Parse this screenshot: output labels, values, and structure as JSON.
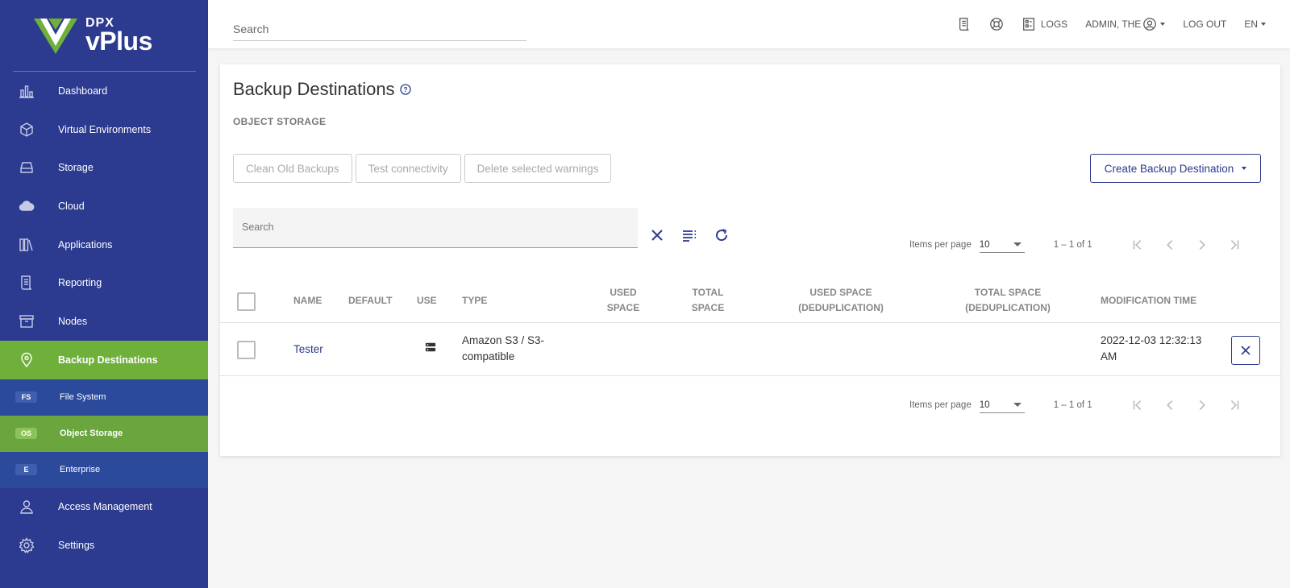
{
  "app": {
    "logo": {
      "brand_small": "DPX",
      "brand_large": "vPlus"
    }
  },
  "sidebar": {
    "items": [
      {
        "label": "Dashboard",
        "icon": "bar-chart-icon"
      },
      {
        "label": "Virtual Environments",
        "icon": "cube-icon"
      },
      {
        "label": "Storage",
        "icon": "hard-drive-icon"
      },
      {
        "label": "Cloud",
        "icon": "cloud-icon"
      },
      {
        "label": "Applications",
        "icon": "books-icon"
      },
      {
        "label": "Reporting",
        "icon": "report-icon"
      },
      {
        "label": "Nodes",
        "icon": "archive-box-icon"
      },
      {
        "label": "Backup Destinations",
        "icon": "location-pin-icon",
        "active": true
      },
      {
        "label": "Access Management",
        "icon": "user-icon"
      },
      {
        "label": "Settings",
        "icon": "gear-icon"
      }
    ],
    "sub_items": [
      {
        "badge": "FS",
        "label": "File System"
      },
      {
        "badge": "OS",
        "label": "Object Storage",
        "active": true
      },
      {
        "badge": "E",
        "label": "Enterprise"
      }
    ],
    "colors": {
      "background": "#2c3a8f",
      "active": "#6fb03a"
    }
  },
  "topbar": {
    "search_placeholder": "Search",
    "logs_label": "LOGS",
    "user_label": "ADMIN, THE",
    "logout_label": "LOG OUT",
    "language": "EN"
  },
  "main": {
    "title": "Backup Destinations",
    "section": "OBJECT STORAGE",
    "buttons": {
      "clean": "Clean Old Backups",
      "test": "Test connectivity",
      "delete_warnings": "Delete selected warnings",
      "create": "Create Backup Destination"
    },
    "table_search_placeholder": "Search",
    "pager": {
      "label": "Items per page",
      "per_page": "10",
      "range": "1 – 1 of 1"
    },
    "columns": {
      "name": "NAME",
      "default": "DEFAULT",
      "use": "USE",
      "type": "TYPE",
      "used_space_1": "USED",
      "used_space_2": "SPACE",
      "total_space_1": "TOTAL",
      "total_space_2": "SPACE",
      "used_dedup_1": "USED SPACE",
      "used_dedup_2": "(DEDUPLICATION)",
      "total_dedup_1": "TOTAL SPACE",
      "total_dedup_2": "(DEDUPLICATION)",
      "mod_time": "MODIFICATION TIME"
    },
    "rows": [
      {
        "name": "Tester",
        "use_icon": "server-icon",
        "type_line1": "Amazon S3 / S3-",
        "type_line2": "compatible",
        "mod_line1": "2022-12-03 12:32:13",
        "mod_line2": "AM"
      }
    ],
    "accent_color": "#2c3a8f"
  }
}
